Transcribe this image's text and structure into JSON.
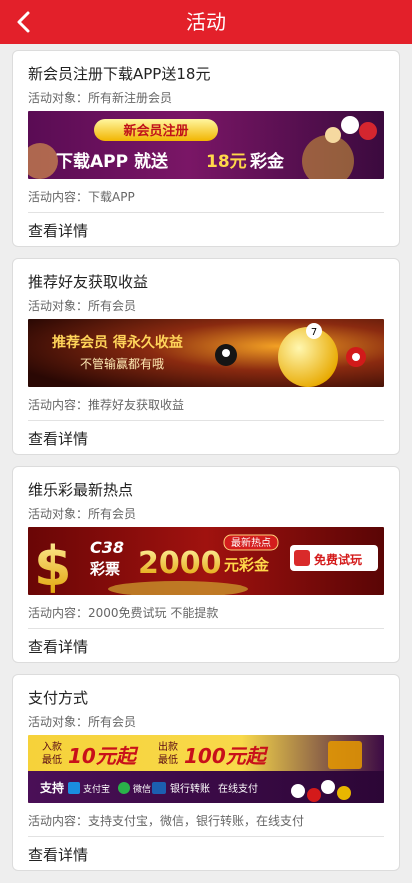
{
  "header": {
    "title": "活动",
    "back_icon": "chevron-left-icon",
    "background": "#e3202a"
  },
  "cards": [
    {
      "title": "新会员注册下载APP送18元",
      "target": "活动对象：所有新注册会员",
      "banner": {
        "badge": "新会员注册",
        "line_a": "下载APP 就送",
        "amount": "18元",
        "line_b": "彩金"
      },
      "content": "活动内容：下载APP",
      "link": "查看详情"
    },
    {
      "title": "推荐好友获取收益",
      "target": "活动对象：所有会员",
      "banner": {
        "headline": "推荐会员 得永久收益",
        "subline": "不管输赢都有哦"
      },
      "content": "活动内容：推荐好友获取收益",
      "link": "查看详情"
    },
    {
      "title": "维乐彩最新热点",
      "target": "活动对象：所有会员",
      "banner": {
        "brand": "C38",
        "brand_sub": "彩票",
        "amount": "2000",
        "amount_sub": "元彩金",
        "tag": "最新热点",
        "button": "免费试玩"
      },
      "content": "活动内容：2000免费试玩 不能提款",
      "link": "查看详情"
    },
    {
      "title": "支付方式",
      "target": "活动对象：所有会员",
      "banner": {
        "dep_label_1": "入款",
        "dep_label_2": "最低",
        "dep_amount": "10元起",
        "wd_label_1": "出款",
        "wd_label_2": "最低",
        "wd_amount": "100元起",
        "support": "支持",
        "method_1": "支付宝",
        "method_2": "微信",
        "method_3": "银行转账",
        "method_4": "在线支付"
      },
      "content": "活动内容：支持支付宝，微信，银行转账，在线支付",
      "link": "查看详情"
    }
  ]
}
